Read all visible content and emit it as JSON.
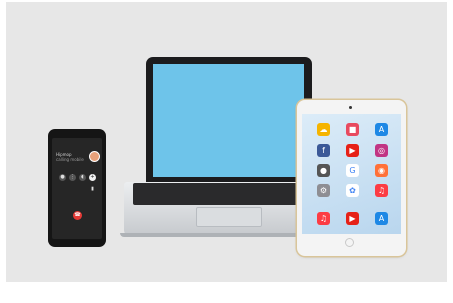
{
  "scene": {
    "description": "Product photo of a smartphone, laptop and tablet",
    "colors": {
      "backdrop": "#e7e7e7",
      "laptop_screen": "#6ec4ea",
      "hangup": "#e53935"
    }
  },
  "phone": {
    "caller_name": "Hipmop",
    "call_status": "calling mobile",
    "controls": [
      "mute-icon",
      "keypad-icon",
      "speaker-icon",
      "add-call-icon",
      "hold-icon"
    ],
    "hangup_icon": "hangup-icon"
  },
  "tablet": {
    "apps": [
      {
        "icon": "weather-app-icon",
        "glyph": "☁",
        "color": "#f5b400"
      },
      {
        "icon": "photo-booth-icon",
        "glyph": "■",
        "color": "#e84a5f"
      },
      {
        "icon": "app-store-icon",
        "glyph": "A",
        "color": "#1e88e5"
      },
      {
        "icon": "facebook-icon",
        "glyph": "f",
        "color": "#3b5998"
      },
      {
        "icon": "youtube-icon",
        "glyph": "▶",
        "color": "#e62117"
      },
      {
        "icon": "instagram-icon",
        "glyph": "◎",
        "color": "#c13584"
      },
      {
        "icon": "camera-icon",
        "glyph": "●",
        "color": "#555555"
      },
      {
        "icon": "google-icon",
        "glyph": "G",
        "color": "#ffffff"
      },
      {
        "icon": "firefox-icon",
        "glyph": "◉",
        "color": "#ff7139"
      },
      {
        "icon": "settings-icon",
        "glyph": "⚙",
        "color": "#8e8e93"
      },
      {
        "icon": "photos-icon",
        "glyph": "✿",
        "color": "#ffffff"
      },
      {
        "icon": "music-icon",
        "glyph": "♫",
        "color": "#fc3c44"
      },
      {
        "icon": "music-dock-icon",
        "glyph": "♫",
        "color": "#fc3c44"
      },
      {
        "icon": "youtube-dock-icon",
        "glyph": "▶",
        "color": "#e62117"
      },
      {
        "icon": "app-store-dock-icon",
        "glyph": "A",
        "color": "#1e88e5"
      }
    ]
  }
}
